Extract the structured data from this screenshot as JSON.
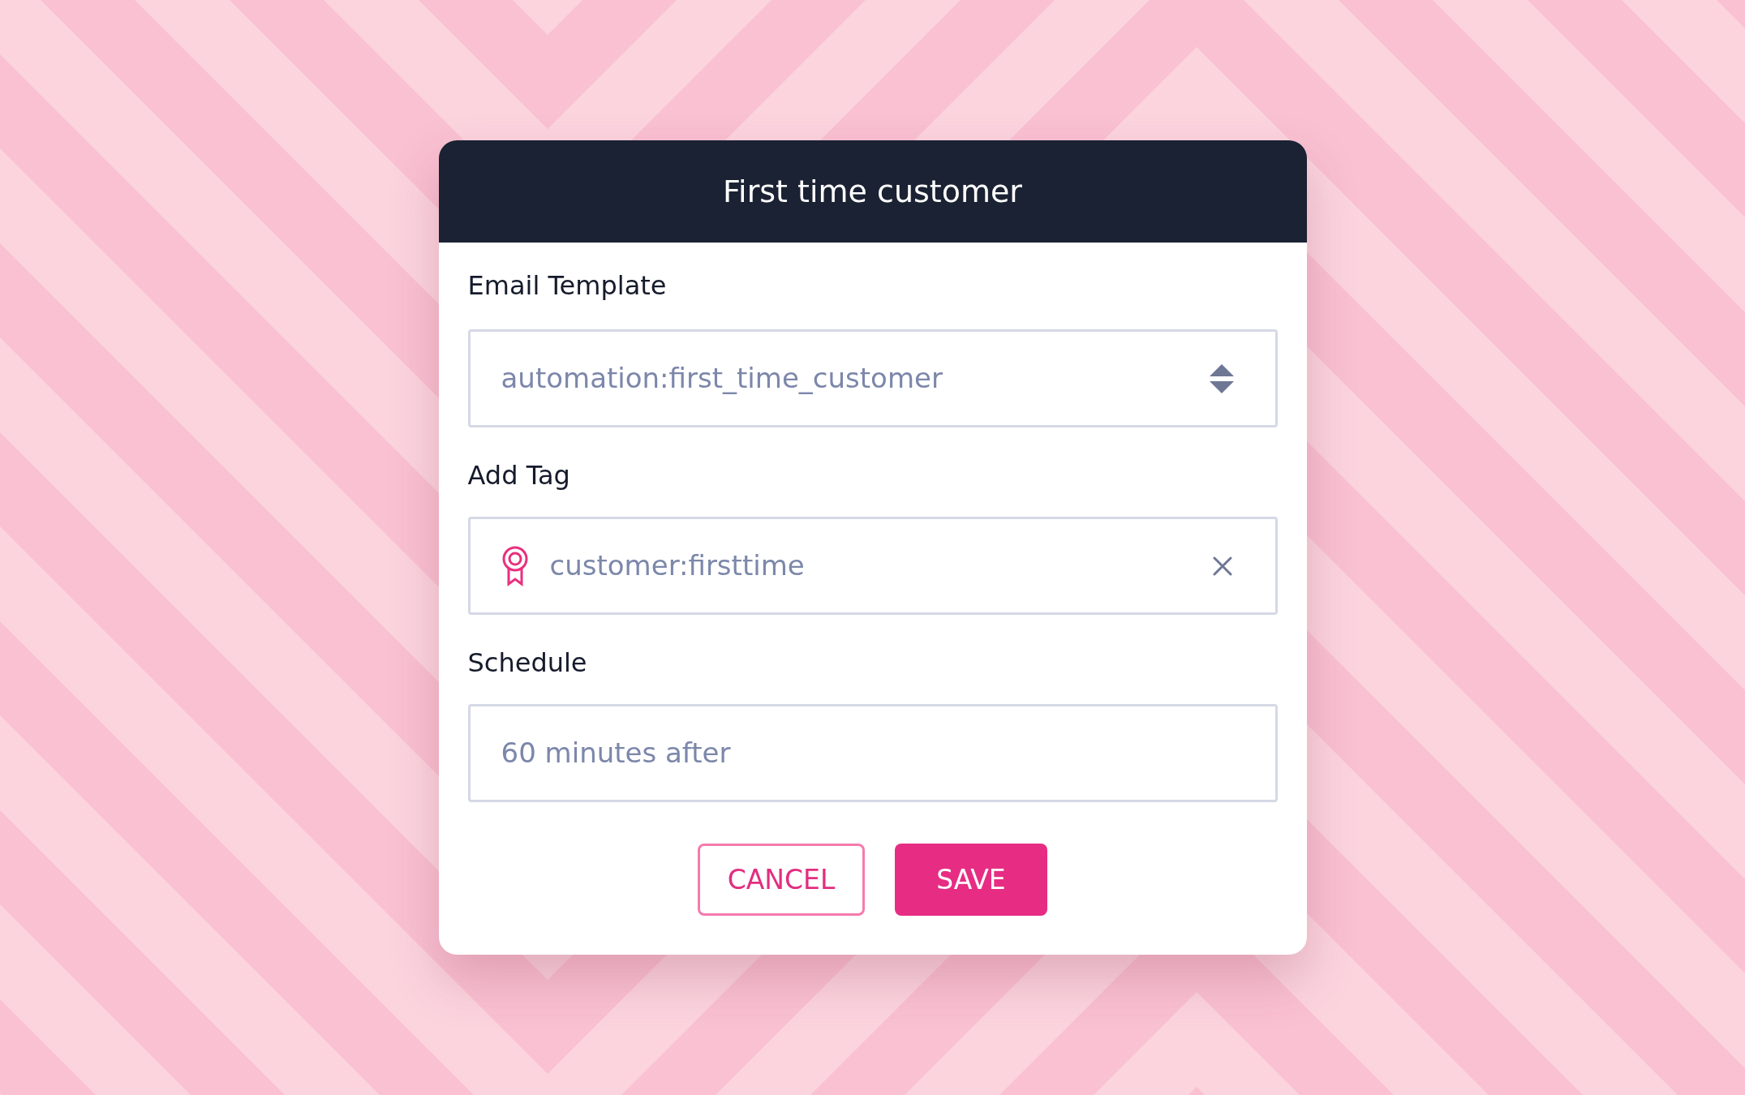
{
  "dialog": {
    "title": "First time customer",
    "fields": [
      {
        "label": "Email Template",
        "kind": "select",
        "value": "automation:first_time_customer"
      },
      {
        "label": "Add Tag",
        "kind": "tag",
        "value": "customer:firsttime"
      },
      {
        "label": "Schedule",
        "kind": "text",
        "value": "60 minutes after"
      }
    ],
    "buttons": [
      {
        "label": "CANCEL",
        "kind": "outline"
      },
      {
        "label": "SAVE",
        "kind": "primary"
      }
    ]
  }
}
